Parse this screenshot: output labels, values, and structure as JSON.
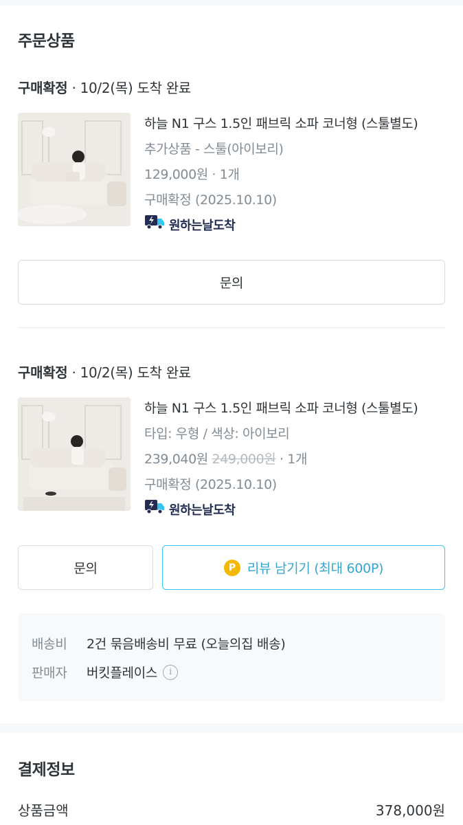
{
  "section_title": "주문상품",
  "items": [
    {
      "status_bold": "구매확정",
      "status_rest": " · 10/2(목) 도착 완료",
      "name": "하늘 N1 구스 1.5인 패브릭 소파 코너형 (스툴별도)",
      "option": "추가상품 - 스툴(아이보리)",
      "price": "129,000원",
      "original_price": "",
      "qty": " · 1개",
      "confirm": "구매확정 (2025.10.10)",
      "badge": "원하는날도착",
      "inquiry_label": "문의"
    },
    {
      "status_bold": "구매확정",
      "status_rest": " · 10/2(목) 도착 완료",
      "name": "하늘 N1 구스 1.5인 패브릭 소파 코너형 (스툴별도)",
      "option": "타입: 우형 / 색상: 아이보리",
      "price": "239,040원",
      "original_price": "249,000원",
      "qty": " · 1개",
      "confirm": "구매확정 (2025.10.10)",
      "badge": "원하는날도착",
      "inquiry_label": "문의",
      "review_label": "리뷰 남기기 (최대 600P)",
      "review_coin": "P"
    }
  ],
  "shipping": {
    "fee_key": "배송비",
    "fee_value": "2건 묶음배송비 무료 (오늘의집 배송)",
    "seller_key": "판매자",
    "seller_value": "버킷플레이스"
  },
  "payment": {
    "title": "결제정보",
    "subtotal_label": "상품금액",
    "subtotal_value": "378,000원"
  },
  "colors": {
    "accent": "#35c5f0",
    "badge_navy": "#232d53",
    "coin": "#f5b800"
  }
}
